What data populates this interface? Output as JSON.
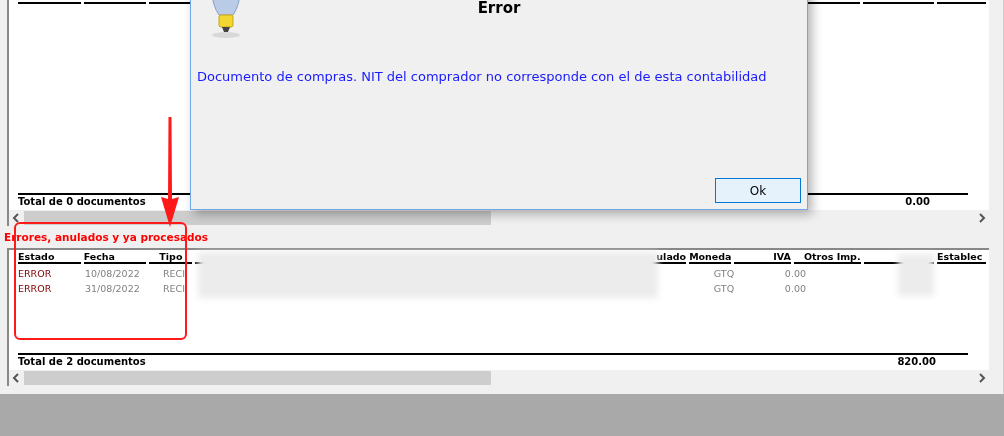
{
  "top_table": {
    "total_label": "Total de 0 documentos",
    "total_amount": "0.00"
  },
  "section_label": "Errores, anulados y ya procesados",
  "bottom_table": {
    "columns": [
      {
        "label": "Estado"
      },
      {
        "label": "Fecha"
      },
      {
        "label": "Tipo"
      },
      {
        "kind": "redacted"
      },
      {
        "label": "ulado"
      },
      {
        "label": "Moneda"
      },
      {
        "label": "IVA"
      },
      {
        "label": "Otros Imp."
      },
      {
        "kind": "redacted"
      },
      {
        "label": "Establec"
      }
    ],
    "rows": [
      {
        "estado": "ERROR",
        "fecha": "10/08/2022",
        "tipo": "RECI",
        "moneda": "GTQ",
        "iva": "0.00"
      },
      {
        "estado": "ERROR",
        "fecha": "31/08/2022",
        "tipo": "RECI",
        "moneda": "GTQ",
        "iva": "0.00"
      }
    ],
    "total_label": "Total de 2 documentos",
    "total_amount": "820.00"
  },
  "dialog": {
    "title": "Error",
    "message": "Documento de compras. NIT del comprador no corresponde con el de esta contabilidad",
    "button": "Ok"
  }
}
